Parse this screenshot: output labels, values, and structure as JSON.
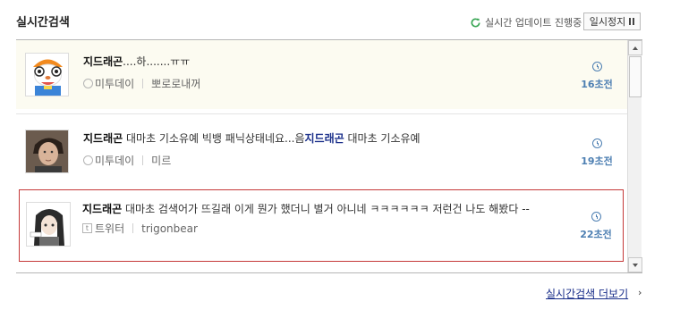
{
  "header": {
    "title": "실시간검색",
    "status_text": "실시간 업데이트 진행중",
    "pause_label": "일시정지"
  },
  "items": [
    {
      "keyword": "지드래곤",
      "text_after": "....하.......ㅠㅠ",
      "service": "미투데이",
      "author": "뽀로로내꺼",
      "time": "16초전",
      "avatar": "pororo-avatar"
    },
    {
      "keyword": "지드래곤",
      "text_mid": " 대마초 기소유예 빅뱅 패닉상태네요...음",
      "keyword2": "지드래곤",
      "text_after": " 대마초 기소유예",
      "service": "미투데이",
      "author": "미르",
      "time": "19초전",
      "avatar": "user-photo-avatar"
    },
    {
      "keyword": "지드래곤",
      "text_after": " 대마초 검색어가 뜨길래 이게 뭔가 했더니 별거 아니네 ㅋㅋㅋㅋㅋㅋ 저런건 나도 해봤다 --",
      "service": "트위터",
      "author": "trigonbear",
      "time": "22초전",
      "avatar": "anime-girl-avatar"
    }
  ],
  "footer": {
    "more_label": "실시간검색 더보기",
    "arrow": "›"
  },
  "colors": {
    "keyword_dark": "#111111",
    "keyword_blue": "#1a2f8a",
    "time_blue": "#4d7fb2",
    "selected_border": "#c53838",
    "highlight_bg": "#fcfbf1"
  }
}
